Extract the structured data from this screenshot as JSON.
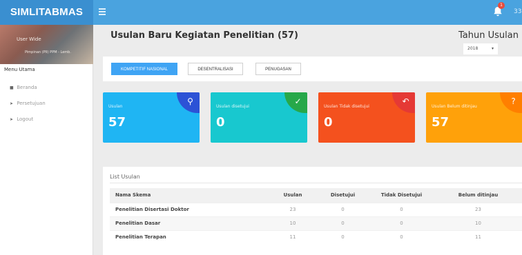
{
  "app": {
    "brand": "SIMLITABMAS",
    "notif_count": "1",
    "top_extra": "33"
  },
  "profile": {
    "name": "User Wide",
    "role": "Pimpinan (PII) PPM - Lemb."
  },
  "sidebar": {
    "title": "Menu Utama",
    "items": [
      {
        "label": "Beranda",
        "icon": "home-icon"
      },
      {
        "label": "Persetujuan",
        "icon": "arrow-right-icon"
      },
      {
        "label": "Logout",
        "icon": "arrow-right-icon"
      }
    ]
  },
  "page": {
    "title": "Usulan Baru Kegiatan Penelitian (57)"
  },
  "year": {
    "label": "Tahun Usulan",
    "selected": "2018"
  },
  "tabs": [
    "KOMPETITIF NASIONAL",
    "DESENTRALISASI",
    "PENUGASAN"
  ],
  "cards": [
    {
      "label": "Usulan",
      "value": "57",
      "color": "#1fb5f3",
      "corner_color": "#2c52d6",
      "icon": "user-search-icon"
    },
    {
      "label": "Usulan disetujui",
      "value": "0",
      "color": "#18c8cf",
      "corner_color": "#27a84a",
      "icon": "check-circle-icon"
    },
    {
      "label": "Usulan Tidak disetujui",
      "value": "0",
      "color": "#f4511e",
      "corner_color": "#e53935",
      "icon": "reply-icon"
    },
    {
      "label": "Usulan Belum ditinjau",
      "value": "57",
      "color": "#ffa10a",
      "corner_color": "#ff7f00",
      "icon": "help-circle-icon"
    }
  ],
  "list": {
    "title": "List Usulan",
    "columns": [
      "Nama Skema",
      "Usulan",
      "Disetujui",
      "Tidak Disetujui",
      "Belum ditinjau"
    ],
    "rows": [
      [
        "Penelitian Disertasi Doktor",
        "23",
        "0",
        "0",
        "23"
      ],
      [
        "Penelitian Dasar",
        "10",
        "0",
        "0",
        "10"
      ],
      [
        "Penelitian Terapan",
        "11",
        "0",
        "0",
        "11"
      ]
    ]
  }
}
